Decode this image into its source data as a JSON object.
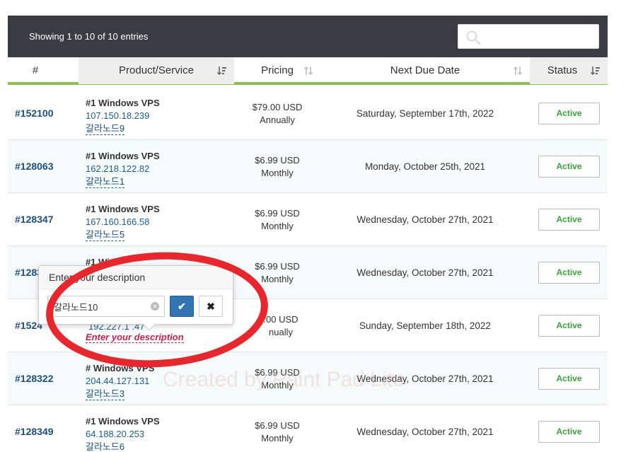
{
  "table_info": "Showing 1 to 10 of 10 entries",
  "search": {
    "placeholder": "",
    "icon": "search-icon"
  },
  "columns": [
    {
      "label": "#",
      "sortable": false
    },
    {
      "label": "Product/Service",
      "sortable": true,
      "sorted": true
    },
    {
      "label": "Pricing",
      "sortable": true
    },
    {
      "label": "Next Due Date",
      "sortable": true
    },
    {
      "label": "Status",
      "sortable": true,
      "sorted": true
    }
  ],
  "rows": [
    {
      "id": "#152100",
      "product": "#1 Windows VPS",
      "ip": "107.150.18.239",
      "desc": "갈라노드9",
      "price": "$79.00 USD",
      "cycle": "Annually",
      "due": "Saturday, September 17th, 2022",
      "status": "Active"
    },
    {
      "id": "#128063",
      "product": "#1 Windows VPS",
      "ip": "162.218.122.82",
      "desc": "갈라노드1",
      "price": "$6.99 USD",
      "cycle": "Monthly",
      "due": "Monday, October 25th, 2021",
      "status": "Active"
    },
    {
      "id": "#128347",
      "product": "#1 Windows VPS",
      "ip": "167.160.166.58",
      "desc": "갈라노드5",
      "price": "$6.99 USD",
      "cycle": "Monthly",
      "due": "Wednesday, October 27th, 2021",
      "status": "Active"
    },
    {
      "id": "#1283",
      "product": "#1 Wi",
      "ip": "",
      "desc": "",
      "price": "$6.99 USD",
      "cycle": "Monthly",
      "due": "Wednesday, October 27th, 2021",
      "status": "Active"
    },
    {
      "id": "#1524",
      "product": "",
      "ip": "192.227.1 .47",
      "desc": "",
      "price": ".00 USD",
      "cycle": "nually",
      "due": "Sunday, September 18th, 2022",
      "status": "Active"
    },
    {
      "id": "#128322",
      "product": "# Windows VPS",
      "ip": "204.44.127.131",
      "desc": "갈라노드3",
      "price": "$6.99 USD",
      "cycle": "Monthly",
      "due": "Wednesday, October 27th, 2021",
      "status": "Active"
    },
    {
      "id": "#128349",
      "product": "#1 Windows VPS",
      "ip": "64.188.20.253",
      "desc": "갈라노드6",
      "price": "$6.99 USD",
      "cycle": "Monthly",
      "due": "Wednesday, October 27th, 2021",
      "status": "Active"
    }
  ],
  "popover": {
    "title": "Enter your description",
    "input_value": "갈라노드10",
    "ok_icon": "check-icon",
    "cancel_icon": "close-icon"
  },
  "empty_description_link": "Enter your description",
  "watermark": "Created by Paint Pad Lite",
  "colors": {
    "header_bar": "#3a3c44",
    "accent_green": "#8cc152",
    "link_blue": "#1d4f83",
    "status_green": "#3aa13a",
    "annotation_red": "#e8262b",
    "primary_button": "#3276b1"
  }
}
